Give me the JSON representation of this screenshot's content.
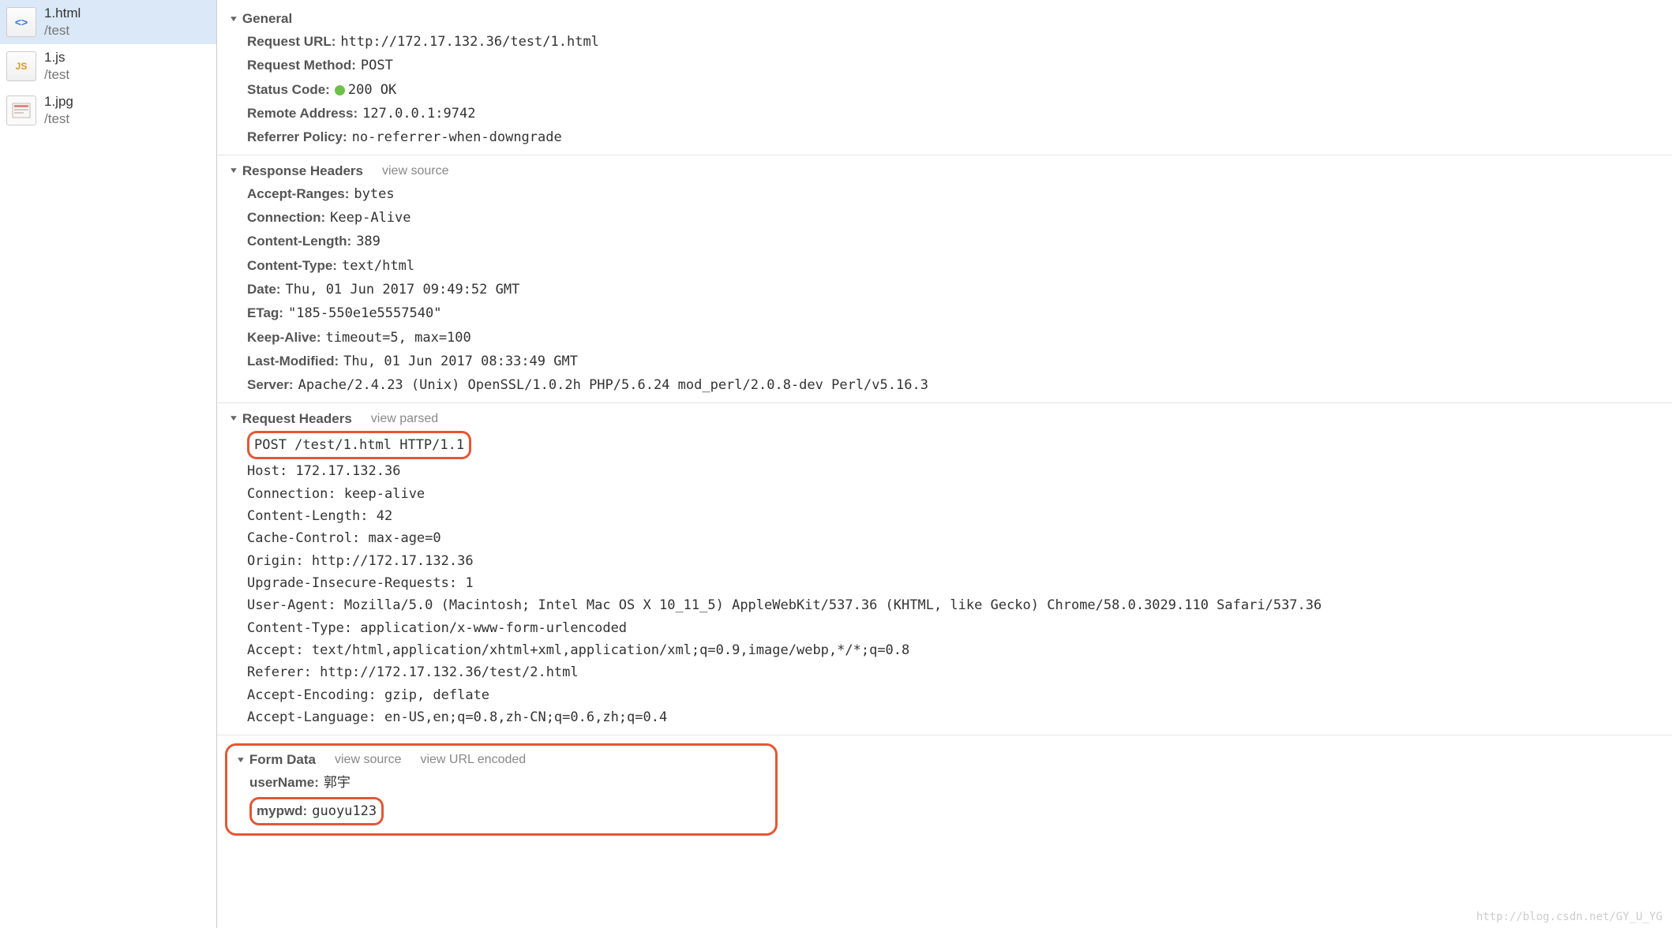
{
  "sidebar": {
    "items": [
      {
        "name": "1.html",
        "path": "/test",
        "type": "html",
        "selected": true
      },
      {
        "name": "1.js",
        "path": "/test",
        "type": "js",
        "selected": false
      },
      {
        "name": "1.jpg",
        "path": "/test",
        "type": "jpg",
        "selected": false
      }
    ]
  },
  "sections": {
    "general": {
      "title": "General",
      "request_url_label": "Request URL:",
      "request_url": "http://172.17.132.36/test/1.html",
      "request_method_label": "Request Method:",
      "request_method": "POST",
      "status_code_label": "Status Code:",
      "status_code": "200 OK",
      "remote_address_label": "Remote Address:",
      "remote_address": "127.0.0.1:9742",
      "referrer_policy_label": "Referrer Policy:",
      "referrer_policy": "no-referrer-when-downgrade"
    },
    "response_headers": {
      "title": "Response Headers",
      "toggle": "view source",
      "rows": [
        {
          "k": "Accept-Ranges:",
          "v": "bytes"
        },
        {
          "k": "Connection:",
          "v": "Keep-Alive"
        },
        {
          "k": "Content-Length:",
          "v": "389"
        },
        {
          "k": "Content-Type:",
          "v": "text/html"
        },
        {
          "k": "Date:",
          "v": "Thu, 01 Jun 2017 09:49:52 GMT"
        },
        {
          "k": "ETag:",
          "v": "\"185-550e1e5557540\""
        },
        {
          "k": "Keep-Alive:",
          "v": "timeout=5, max=100"
        },
        {
          "k": "Last-Modified:",
          "v": "Thu, 01 Jun 2017 08:33:49 GMT"
        },
        {
          "k": "Server:",
          "v": "Apache/2.4.23 (Unix) OpenSSL/1.0.2h PHP/5.6.24 mod_perl/2.0.8-dev Perl/v5.16.3"
        }
      ]
    },
    "request_headers": {
      "title": "Request Headers",
      "toggle": "view parsed",
      "first_line": "POST /test/1.html HTTP/1.1",
      "lines": [
        "Host: 172.17.132.36",
        "Connection: keep-alive",
        "Content-Length: 42",
        "Cache-Control: max-age=0",
        "Origin: http://172.17.132.36",
        "Upgrade-Insecure-Requests: 1",
        "User-Agent: Mozilla/5.0 (Macintosh; Intel Mac OS X 10_11_5) AppleWebKit/537.36 (KHTML, like Gecko) Chrome/58.0.3029.110 Safari/537.36",
        "Content-Type: application/x-www-form-urlencoded",
        "Accept: text/html,application/xhtml+xml,application/xml;q=0.9,image/webp,*/*;q=0.8",
        "Referer: http://172.17.132.36/test/2.html",
        "Accept-Encoding: gzip, deflate",
        "Accept-Language: en-US,en;q=0.8,zh-CN;q=0.6,zh;q=0.4"
      ]
    },
    "form_data": {
      "title": "Form Data",
      "toggle1": "view source",
      "toggle2": "view URL encoded",
      "rows": [
        {
          "k": "userName:",
          "v": "郭宇"
        },
        {
          "k": "mypwd:",
          "v": "guoyu123",
          "highlight": true
        }
      ]
    }
  },
  "watermark": "http://blog.csdn.net/GY_U_YG"
}
